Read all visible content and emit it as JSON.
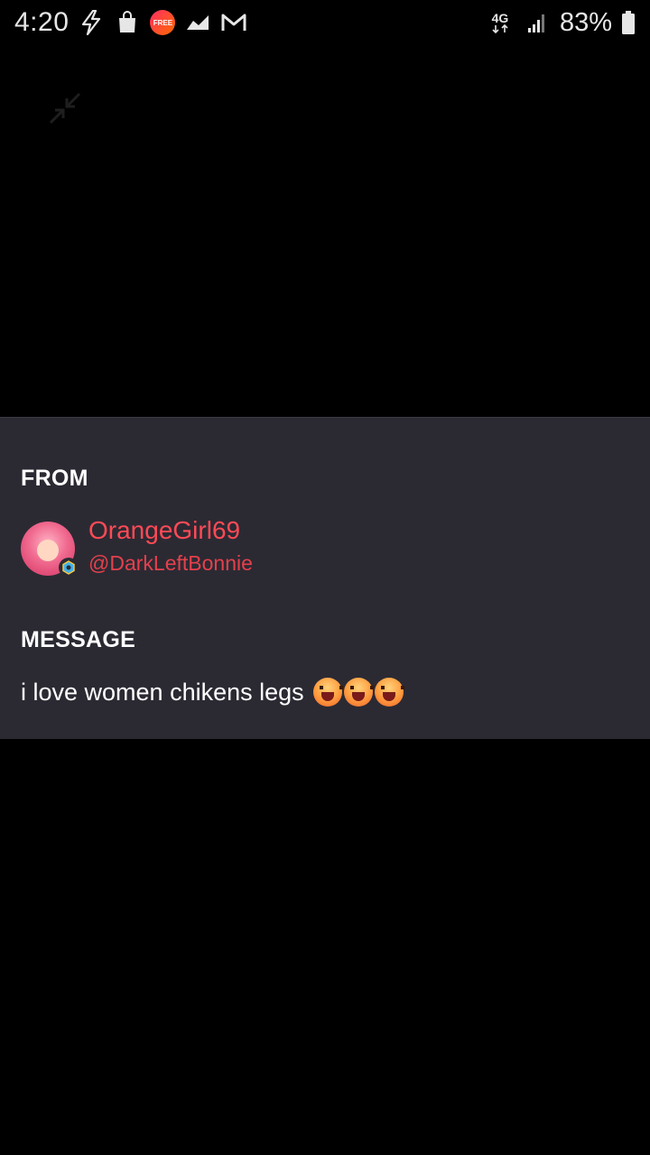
{
  "status_bar": {
    "time": "4:20",
    "free_badge": "FREE",
    "network": "4G",
    "battery_percent": "83%"
  },
  "icons": {
    "left": [
      "lightning-bolt-icon",
      "shopping-bag-icon",
      "free-app-icon",
      "chart-icon",
      "gmail-icon"
    ],
    "right": [
      "4g-icon",
      "signal-icon",
      "battery-icon"
    ],
    "collapse": "collapse-arrows-icon"
  },
  "card": {
    "from_label": "FROM",
    "display_name": "OrangeGirl69",
    "username": "@DarkLeftBonnie",
    "message_label": "MESSAGE",
    "message_body": "i love women chikens legs",
    "emoji_count": 3
  },
  "colors": {
    "background": "#000000",
    "card_background": "#2b2a33",
    "name_red": "#ff4a56",
    "username_red": "#e5404c"
  }
}
